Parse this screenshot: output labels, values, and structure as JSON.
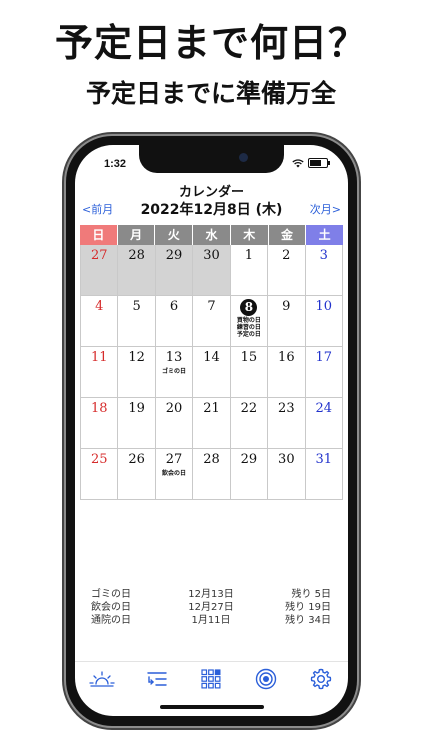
{
  "promo": {
    "headline": "予定日まで何日？",
    "subheadline": "予定日までに準備万全"
  },
  "status": {
    "time": "1:32",
    "battery_level": 0.7
  },
  "calendar": {
    "title": "カレンダー",
    "date": "2022年12月8日 (木)",
    "prev_label": "<前月",
    "next_label": "次月>",
    "colors": {
      "sunday": "#f07a7a",
      "weekday": "#8a8a8a",
      "saturday": "#7f7fe8"
    },
    "weekdays": [
      "日",
      "月",
      "火",
      "水",
      "木",
      "金",
      "土"
    ],
    "weeks": [
      [
        {
          "d": "27",
          "other": true
        },
        {
          "d": "28",
          "other": true
        },
        {
          "d": "29",
          "other": true
        },
        {
          "d": "30",
          "other": true
        },
        {
          "d": "1"
        },
        {
          "d": "2"
        },
        {
          "d": "3"
        }
      ],
      [
        {
          "d": "4"
        },
        {
          "d": "5"
        },
        {
          "d": "6"
        },
        {
          "d": "7"
        },
        {
          "d": "8",
          "today": true,
          "events": [
            "買物の日",
            "練習の日",
            "予定の日"
          ]
        },
        {
          "d": "9"
        },
        {
          "d": "10"
        }
      ],
      [
        {
          "d": "11"
        },
        {
          "d": "12"
        },
        {
          "d": "13",
          "events": [
            "ゴミの日"
          ]
        },
        {
          "d": "14"
        },
        {
          "d": "15"
        },
        {
          "d": "16"
        },
        {
          "d": "17"
        }
      ],
      [
        {
          "d": "18"
        },
        {
          "d": "19"
        },
        {
          "d": "20"
        },
        {
          "d": "21"
        },
        {
          "d": "22"
        },
        {
          "d": "23"
        },
        {
          "d": "24"
        }
      ],
      [
        {
          "d": "25"
        },
        {
          "d": "26"
        },
        {
          "d": "27",
          "events": [
            "飲会の日"
          ]
        },
        {
          "d": "28"
        },
        {
          "d": "29"
        },
        {
          "d": "30"
        },
        {
          "d": "31"
        }
      ]
    ]
  },
  "summary": [
    {
      "name": "ゴミの日",
      "date": "12月13日",
      "remaining": "残り 5日"
    },
    {
      "name": "飲会の日",
      "date": "12月27日",
      "remaining": "残り 19日"
    },
    {
      "name": "通院の日",
      "date": "1月11日",
      "remaining": "残り 34日"
    }
  ],
  "tabs": [
    {
      "name": "tab-today",
      "icon": "sunrise-icon"
    },
    {
      "name": "tab-list",
      "icon": "list-icon"
    },
    {
      "name": "tab-calendar",
      "icon": "grid-icon"
    },
    {
      "name": "tab-target",
      "icon": "target-icon"
    },
    {
      "name": "tab-settings",
      "icon": "gear-icon"
    }
  ],
  "accent": "#2b5fd9"
}
